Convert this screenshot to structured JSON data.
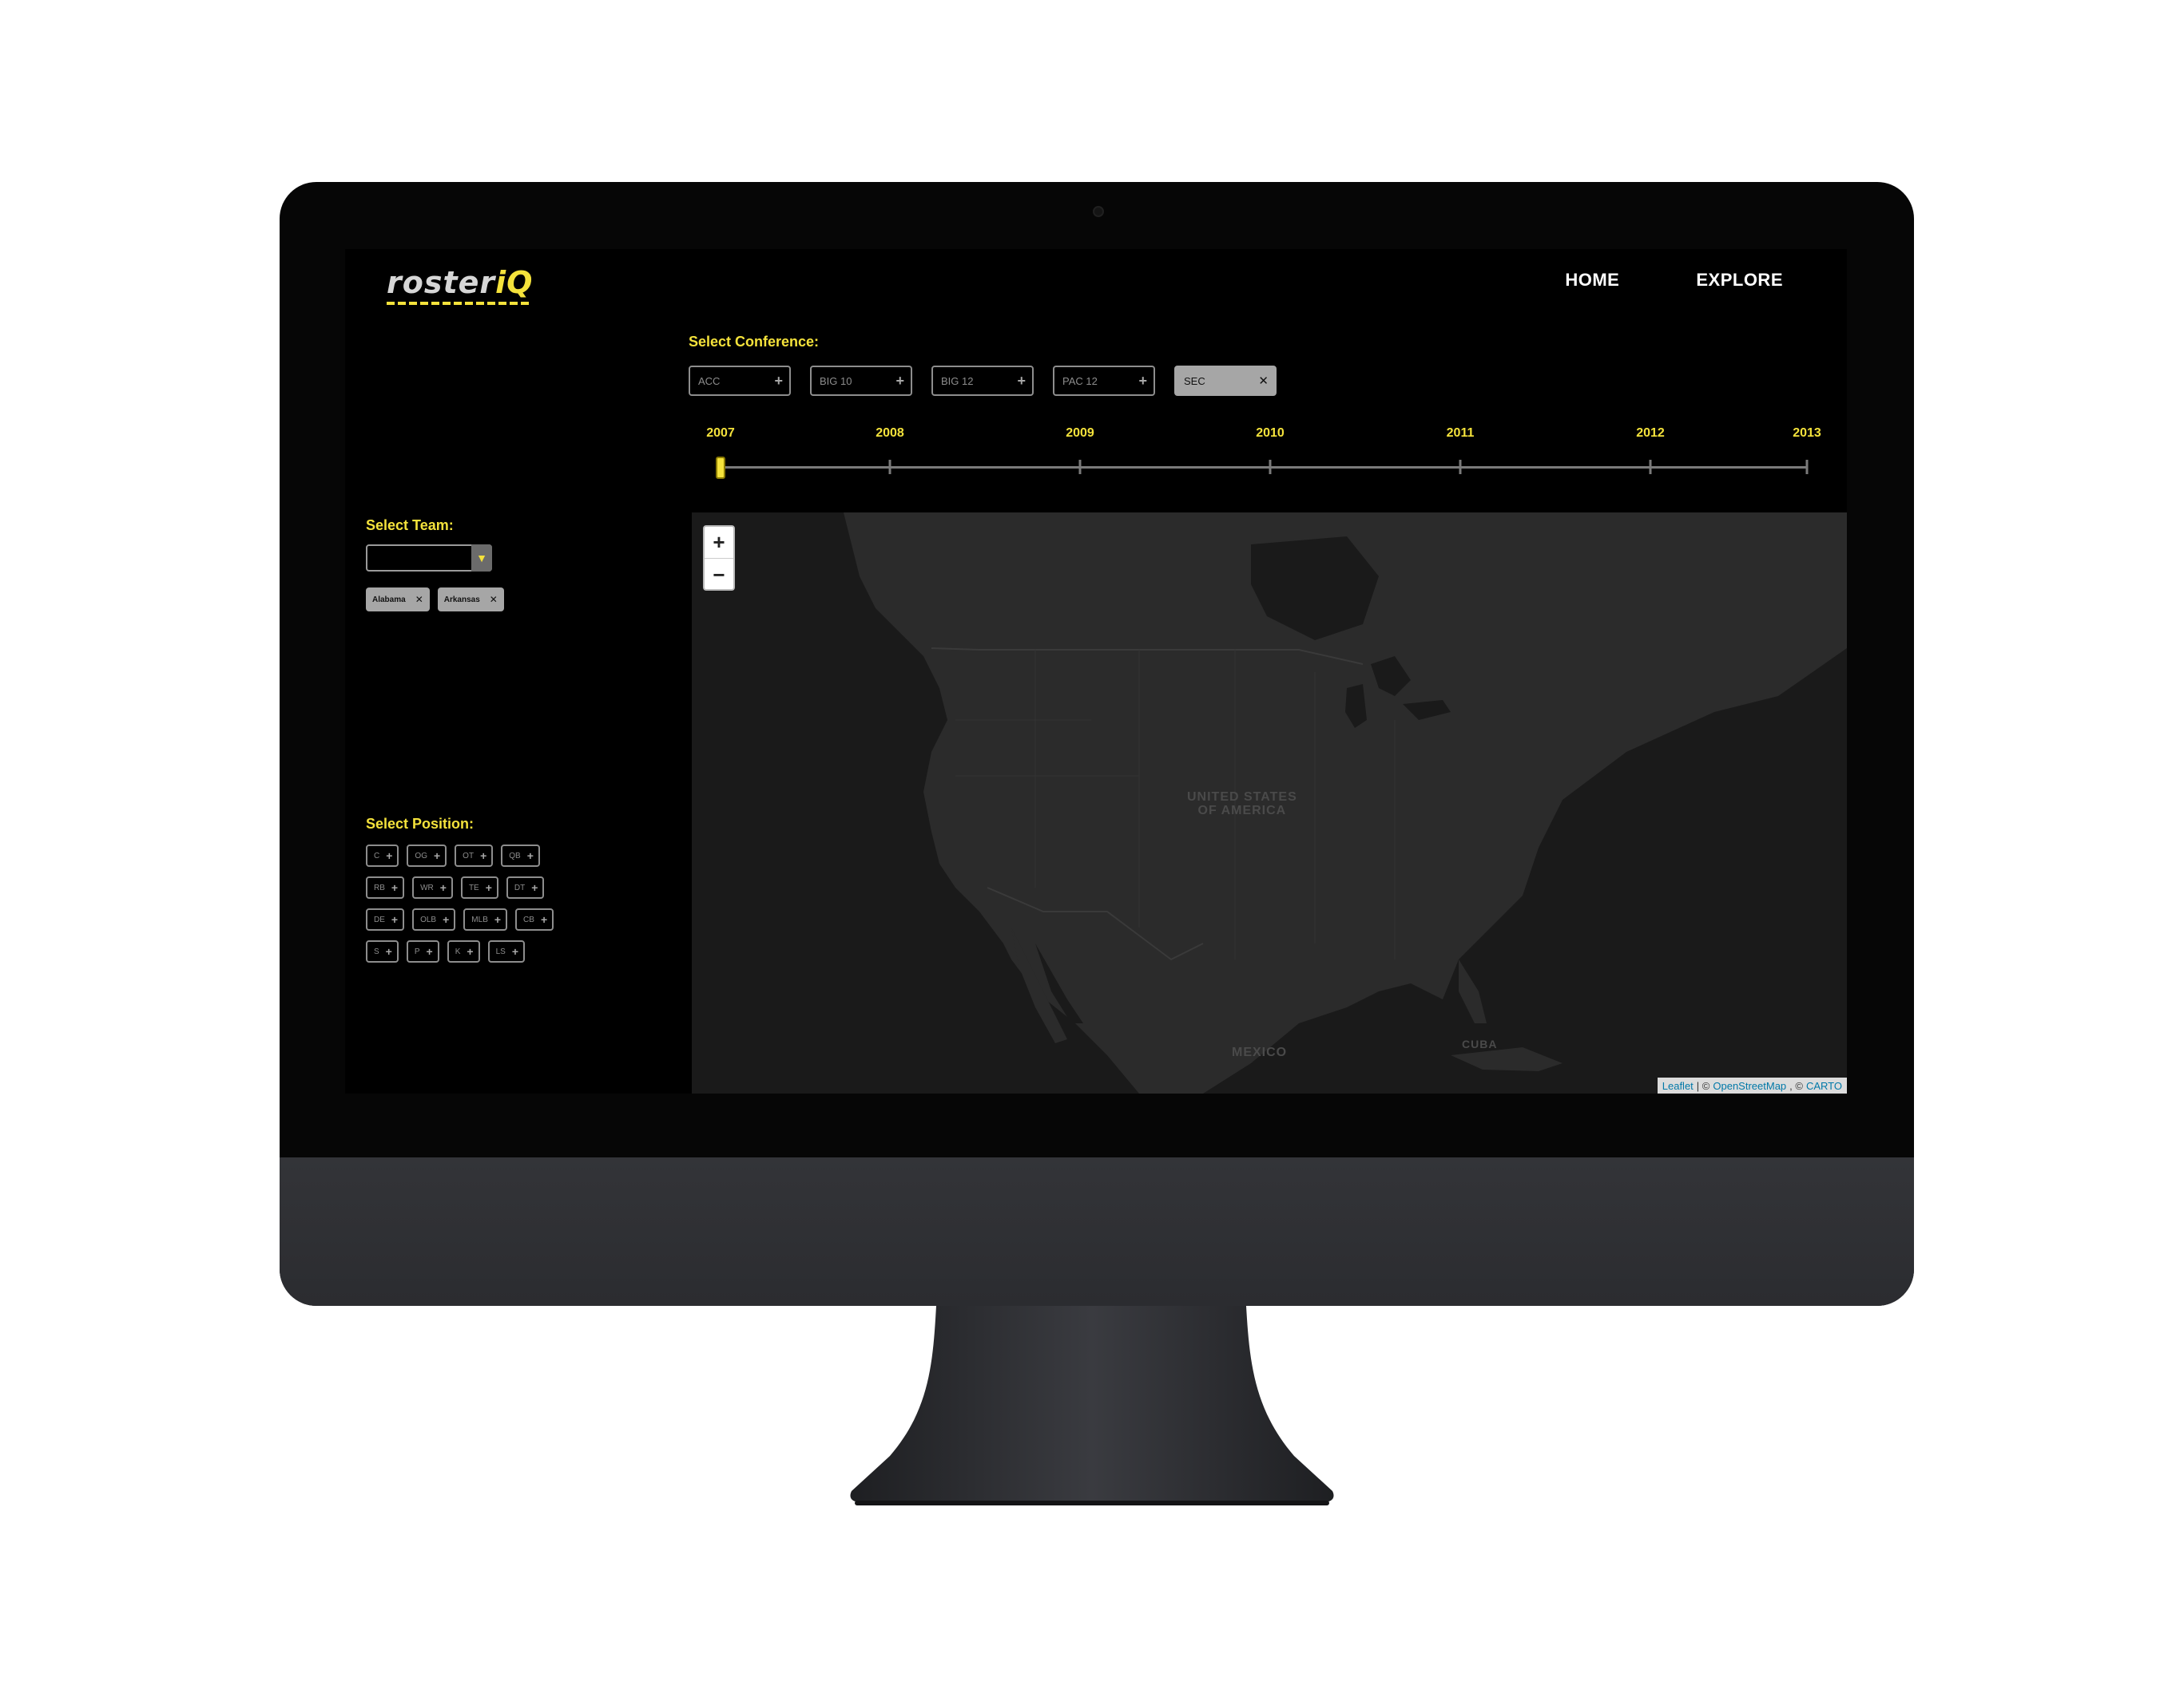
{
  "app": {
    "logo_text": "roster",
    "logo_accent": "iQ",
    "nav": [
      {
        "label": "HOME"
      },
      {
        "label": "EXPLORE"
      }
    ]
  },
  "conference": {
    "label": "Select Conference:",
    "chips": [
      {
        "label": "ACC",
        "selected": false
      },
      {
        "label": "BIG 10",
        "selected": false
      },
      {
        "label": "BIG 12",
        "selected": false
      },
      {
        "label": "PAC 12",
        "selected": false
      },
      {
        "label": "SEC",
        "selected": true
      }
    ]
  },
  "timeline": {
    "years": [
      "2007",
      "2008",
      "2009",
      "2010",
      "2011",
      "2012",
      "2013"
    ],
    "selected_year": "2007"
  },
  "team": {
    "label": "Select Team:",
    "dropdown_value": "",
    "selected": [
      "Alabama",
      "Arkansas"
    ]
  },
  "position": {
    "label": "Select Position:",
    "rows": [
      [
        "C",
        "OG",
        "OT",
        "QB"
      ],
      [
        "RB",
        "WR",
        "TE",
        "DT"
      ],
      [
        "DE",
        "OLB",
        "MLB",
        "CB"
      ],
      [
        "S",
        "P",
        "K",
        "LS"
      ]
    ]
  },
  "map": {
    "zoom_in": "+",
    "zoom_out": "−",
    "labels": {
      "usa": "UNITED STATES\nOF AMERICA",
      "mexico": "MEXICO",
      "cuba": "CUBA"
    },
    "attribution": {
      "leaflet": "Leaflet",
      "sep1": "| ©",
      "osm": "OpenStreetMap",
      "sep2": ", ©",
      "carto": "CARTO"
    }
  },
  "colors": {
    "accent": "#f4e23b",
    "background": "#000000",
    "map_land": "#2b2b2b",
    "map_water": "#1a1a1a",
    "chip_selected": "#a6a6a6"
  }
}
